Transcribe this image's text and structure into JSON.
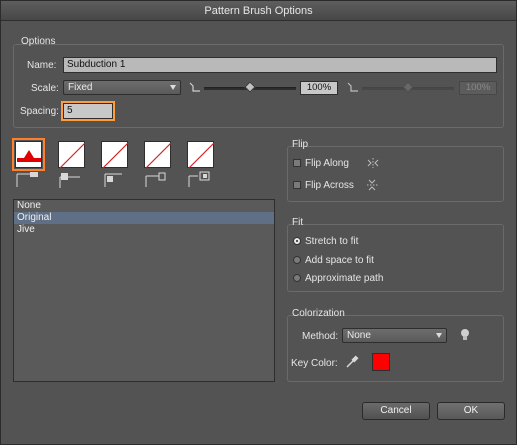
{
  "window": {
    "title": "Pattern Brush Options"
  },
  "options": {
    "group_label": "Options",
    "name_label": "Name:",
    "name_value": "Subduction 1",
    "scale_label": "Scale:",
    "scale_method": "Fixed",
    "scale_percent": "100%",
    "scale_percent_max": "100%",
    "spacing_label": "Spacing:",
    "spacing_value": "5"
  },
  "tiles": {
    "selected_index": 0,
    "items": [
      "side-tile",
      "outer-corner-tile",
      "inner-corner-tile",
      "start-tile",
      "end-tile"
    ]
  },
  "pattern_list": {
    "items": [
      "None",
      "Original",
      "Jive"
    ],
    "selected": "Original"
  },
  "flip": {
    "group_label": "Flip",
    "flip_along": "Flip Along",
    "flip_across": "Flip Across",
    "flip_along_checked": false,
    "flip_across_checked": false
  },
  "fit": {
    "group_label": "Fit",
    "options": [
      "Stretch to fit",
      "Add space to fit",
      "Approximate path"
    ],
    "selected": "Stretch to fit"
  },
  "colorization": {
    "group_label": "Colorization",
    "method_label": "Method:",
    "method_value": "None",
    "key_color_label": "Key Color:",
    "key_color": "#ff0000"
  },
  "buttons": {
    "cancel": "Cancel",
    "ok": "OK"
  },
  "colors": {
    "dialog_bg": "#535353",
    "selection": "#5f6f86",
    "tile_highlight": "#ff7f2a"
  }
}
